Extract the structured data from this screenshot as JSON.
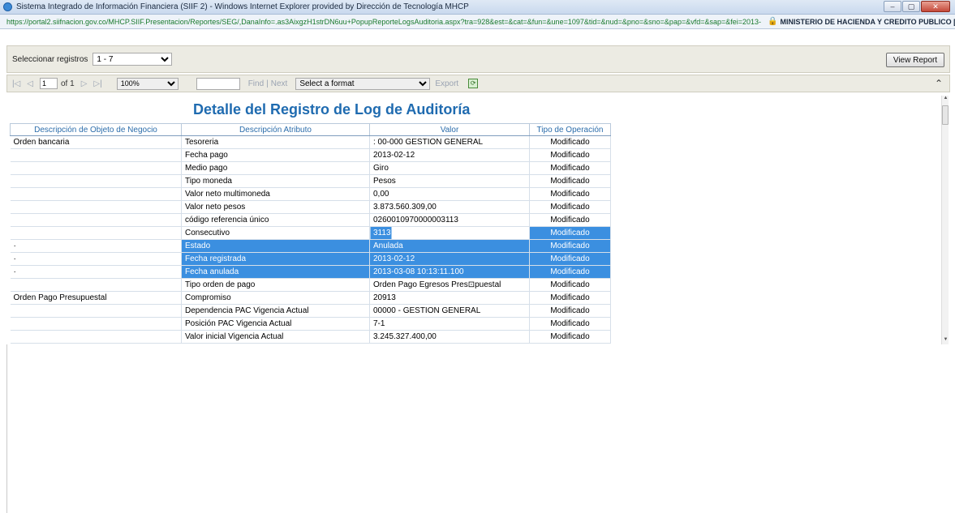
{
  "window": {
    "title": "Sistema Integrado de Información Financiera (SIIF 2) - Windows Internet Explorer provided by Dirección de Tecnología MHCP",
    "buttons": {
      "minimize": "–",
      "maximize": "▢",
      "close": "✕"
    }
  },
  "address": {
    "url": "https://portal2.siifnacion.gov.co/MHCP.SIIF.Presentacion/Reportes/SEG/,DanaInfo=.as3AixgzH1strDN6uu+PopupReporteLogsAuditoria.aspx?tra=928&est=&cat=&fun=&une=1097&tid=&nud=&pno=&sno=&pap=&vfd=&sap=&fei=2013-",
    "site": "MINISTERIO DE HACIENDA Y CREDITO PUBLICO [..."
  },
  "params": {
    "label": "Seleccionar registros",
    "selected": "1 - 7",
    "view_report": "View Report"
  },
  "toolbar": {
    "first": "|◁",
    "prev": "◁",
    "page": "1",
    "of": "of 1",
    "next": "▷",
    "last": "▷|",
    "zoom": "100%",
    "find": "Find",
    "sep": "|",
    "next_link": "Next",
    "format": "Select a format",
    "export": "Export",
    "refresh_icon": "⟳",
    "collapse_icon": "⌃"
  },
  "report": {
    "title": "Detalle del Registro de Log de Auditoría",
    "columns": [
      "Descripción de Objeto de Negocio",
      "Descripción Atributo",
      "Valor",
      "Tipo de Operación"
    ],
    "rows": [
      {
        "obj": "Orden bancaria",
        "attr": "Tesoreria",
        "val": ":            00-000              GESTION GENERAL",
        "op": "Modificado",
        "hl": false
      },
      {
        "obj": "",
        "attr": "Fecha pago",
        "val": "2013-02-12",
        "op": "Modificado",
        "hl": false
      },
      {
        "obj": "",
        "attr": "Medio pago",
        "val": "Giro",
        "op": "Modificado",
        "hl": false
      },
      {
        "obj": "",
        "attr": "Tipo moneda",
        "val": "Pesos",
        "op": "Modificado",
        "hl": false
      },
      {
        "obj": "",
        "attr": "Valor neto multimoneda",
        "val": "0,00",
        "op": "Modificado",
        "hl": false
      },
      {
        "obj": "",
        "attr": "Valor neto pesos",
        "val": "3.873.560.309,00",
        "op": "Modificado",
        "hl": false
      },
      {
        "obj": "",
        "attr": "código referencia único",
        "val": "0260010970000003113",
        "op": "Modificado",
        "hl": false
      },
      {
        "obj": "",
        "attr": "Consecutivo",
        "val": "3113",
        "op": "Modificado",
        "hl": "partial"
      },
      {
        "obj": "·",
        "attr": "Estado",
        "val": "Anulada",
        "op": "Modificado",
        "hl": true
      },
      {
        "obj": "·",
        "attr": "Fecha registrada",
        "val": "2013-02-12",
        "op": "Modificado",
        "hl": true
      },
      {
        "obj": "·",
        "attr": "Fecha anulada",
        "val": "2013-03-08 10:13:11.100",
        "op": "Modificado",
        "hl": true
      },
      {
        "obj": "",
        "attr": "Tipo orden de pago",
        "val": "Orden Pago Egresos Pres⊡puestal",
        "op": "Modificado",
        "hl": false
      },
      {
        "obj": "Orden Pago Presupuestal",
        "attr": "Compromiso",
        "val": "20913",
        "op": "Modificado",
        "hl": false
      },
      {
        "obj": "",
        "attr": "Dependencia PAC Vigencia Actual",
        "val": "00000 -            GESTION GENERAL",
        "op": "Modificado",
        "hl": false
      },
      {
        "obj": "",
        "attr": "Posición PAC Vigencia Actual",
        "val": "7-1",
        "op": "Modificado",
        "hl": false
      },
      {
        "obj": "",
        "attr": "Valor inicial Vigencia Actual",
        "val": "3.245.327.400,00",
        "op": "Modificado",
        "hl": false
      }
    ]
  },
  "scroll": {
    "up": "▲",
    "down": "▼"
  }
}
